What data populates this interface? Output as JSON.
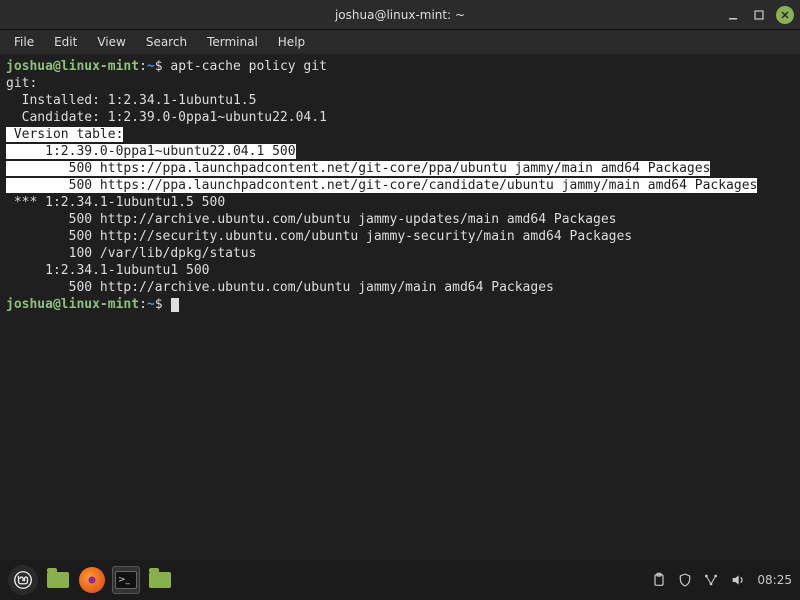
{
  "window": {
    "title": "joshua@linux-mint: ~"
  },
  "menubar": {
    "file": "File",
    "edit": "Edit",
    "view": "View",
    "search": "Search",
    "terminal": "Terminal",
    "help": "Help"
  },
  "prompt": {
    "user_host": "joshua@linux-mint",
    "colon": ":",
    "path": "~",
    "dollar": "$ "
  },
  "command": "apt-cache policy git",
  "output": {
    "l1": "git:",
    "l2": "  Installed: 1:2.34.1-1ubuntu1.5",
    "l3": "  Candidate: 1:2.39.0-0ppa1~ubuntu22.04.1",
    "l4": " Version table:",
    "l5": "     1:2.39.0-0ppa1~ubuntu22.04.1 500",
    "l6": "        500 https://ppa.launchpadcontent.net/git-core/ppa/ubuntu jammy/main amd64 Packages",
    "l7": "        500 https://ppa.launchpadcontent.net/git-core/candidate/ubuntu jammy/main amd64 Packages",
    "l8": " *** 1:2.34.1-1ubuntu1.5 500",
    "l9": "        500 http://archive.ubuntu.com/ubuntu jammy-updates/main amd64 Packages",
    "l10": "        500 http://security.ubuntu.com/ubuntu jammy-security/main amd64 Packages",
    "l11": "        100 /var/lib/dpkg/status",
    "l12": "     1:2.34.1-1ubuntu1 500",
    "l13": "        500 http://archive.ubuntu.com/ubuntu jammy/main amd64 Packages"
  },
  "taskbar": {
    "clock": "08:25"
  }
}
